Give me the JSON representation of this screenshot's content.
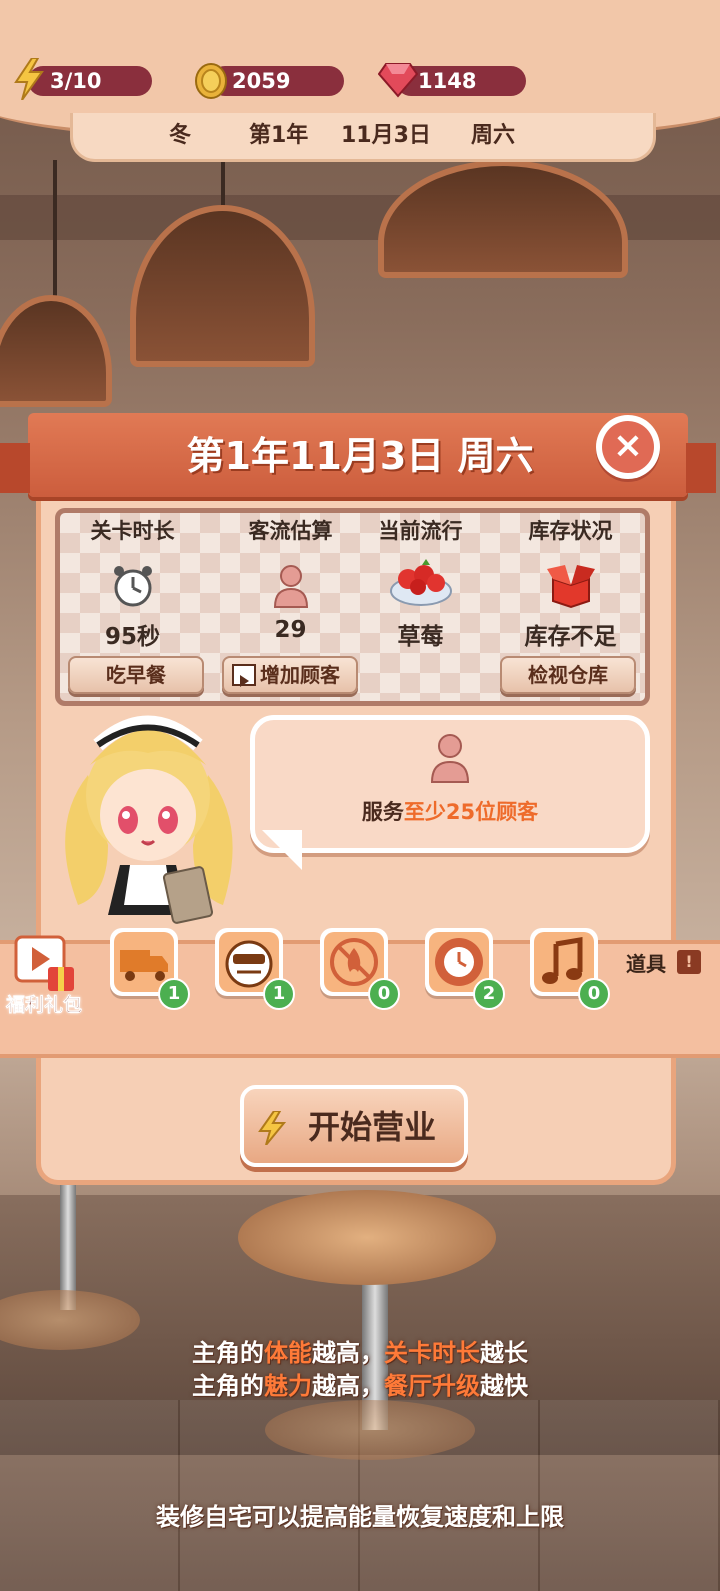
{
  "resources": {
    "energy": "3/10",
    "coins": "2059",
    "gems": "1148"
  },
  "date_bar": {
    "season": "冬",
    "year": "第1年",
    "date": "11月3日",
    "weekday": "周六"
  },
  "dialog": {
    "title": "第1年11月3日 周六",
    "close_label": "×"
  },
  "info": {
    "duration": {
      "header": "关卡时长",
      "value": "95秒",
      "button": "吃早餐"
    },
    "traffic": {
      "header": "客流估算",
      "value": "29",
      "button": "增加顾客"
    },
    "trend": {
      "header": "当前流行",
      "value": "草莓"
    },
    "stock": {
      "header": "库存状况",
      "value": "库存不足",
      "button": "检视仓库"
    }
  },
  "goal": {
    "prefix": "服务",
    "highlight": "至少25位顾客"
  },
  "gift": {
    "label": "福利礼包"
  },
  "tools": [
    {
      "icon": "delivery-truck-icon",
      "count": "1"
    },
    {
      "icon": "sign-icon",
      "count": "1"
    },
    {
      "icon": "no-fire-icon",
      "count": "0"
    },
    {
      "icon": "clock-gear-icon",
      "count": "2"
    },
    {
      "icon": "music-note-icon",
      "count": "0"
    }
  ],
  "props_label": "道具",
  "start_button": "开始营业",
  "tips": {
    "line1": {
      "a": "主角的",
      "b": "体能",
      "c": "越高，",
      "d": "关卡时长",
      "e": "越长"
    },
    "line2": {
      "a": "主角的",
      "b": "魅力",
      "c": "越高，",
      "d": "餐厅升级",
      "e": "越快"
    },
    "line3": "装修自宅可以提高能量恢复速度和上限"
  },
  "colors": {
    "accent": "#e17a55",
    "highlight": "#ff7a38",
    "badge": "#4caf50",
    "resource_pill": "#8a2f3d"
  }
}
